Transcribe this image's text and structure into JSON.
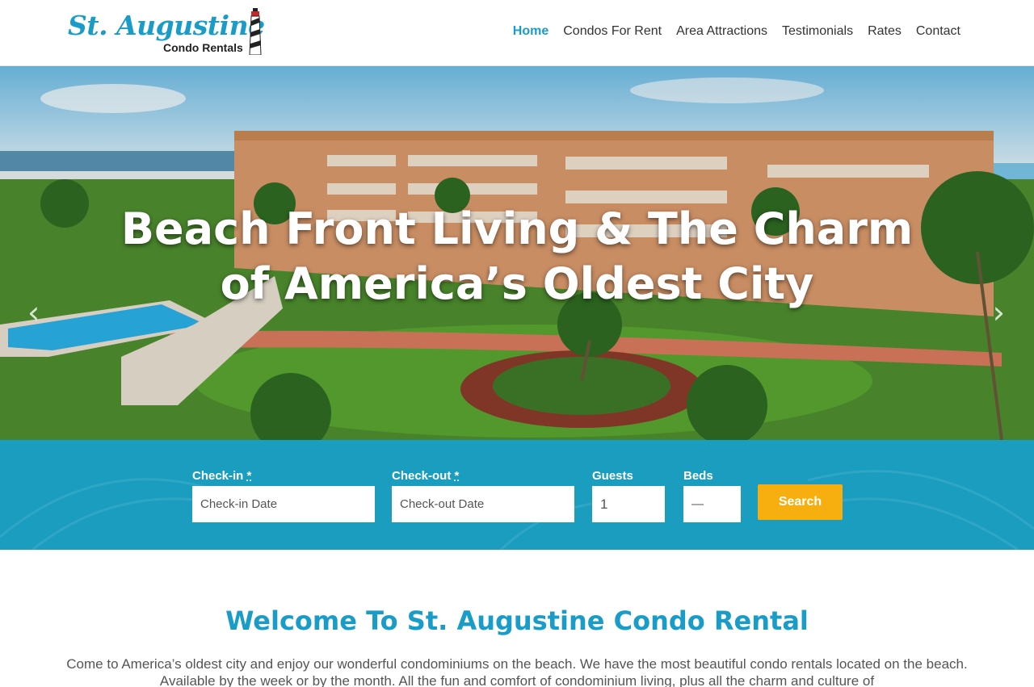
{
  "brand": {
    "name": "St. Augustine",
    "sub": "Condo Rentals",
    "color": "#1a9cc9"
  },
  "nav": {
    "items": [
      {
        "label": "Home",
        "active": true
      },
      {
        "label": "Condos For Rent",
        "active": false
      },
      {
        "label": "Area Attractions",
        "active": false
      },
      {
        "label": "Testimonials",
        "active": false
      },
      {
        "label": "Rates",
        "active": false
      },
      {
        "label": "Contact",
        "active": false
      }
    ]
  },
  "hero": {
    "title_line1": "Beach Front Living & The Charm",
    "title_line2": "of America’s Oldest City",
    "prev_icon": "chevron-left-icon",
    "next_icon": "chevron-right-icon"
  },
  "booking": {
    "checkin_label": "Check-in",
    "checkin_placeholder": "Check-in Date",
    "checkout_label": "Check-out",
    "checkout_placeholder": "Check-out Date",
    "required_mark": "*",
    "guests_label": "Guests",
    "guests_value": "1",
    "beds_label": "Beds",
    "beds_value": "—",
    "search_label": "Search",
    "bar_color": "#1a9dbf",
    "button_color": "#f7ae0f"
  },
  "welcome": {
    "title": "Welcome To St. Augustine Condo Rental",
    "text": "Come to America’s oldest city and enjoy our wonderful condominiums on the beach. We have the most beautiful condo rentals located on the beach. Available by the week or by the month. All the fun and comfort of condominium living, plus all the charm and culture of"
  }
}
